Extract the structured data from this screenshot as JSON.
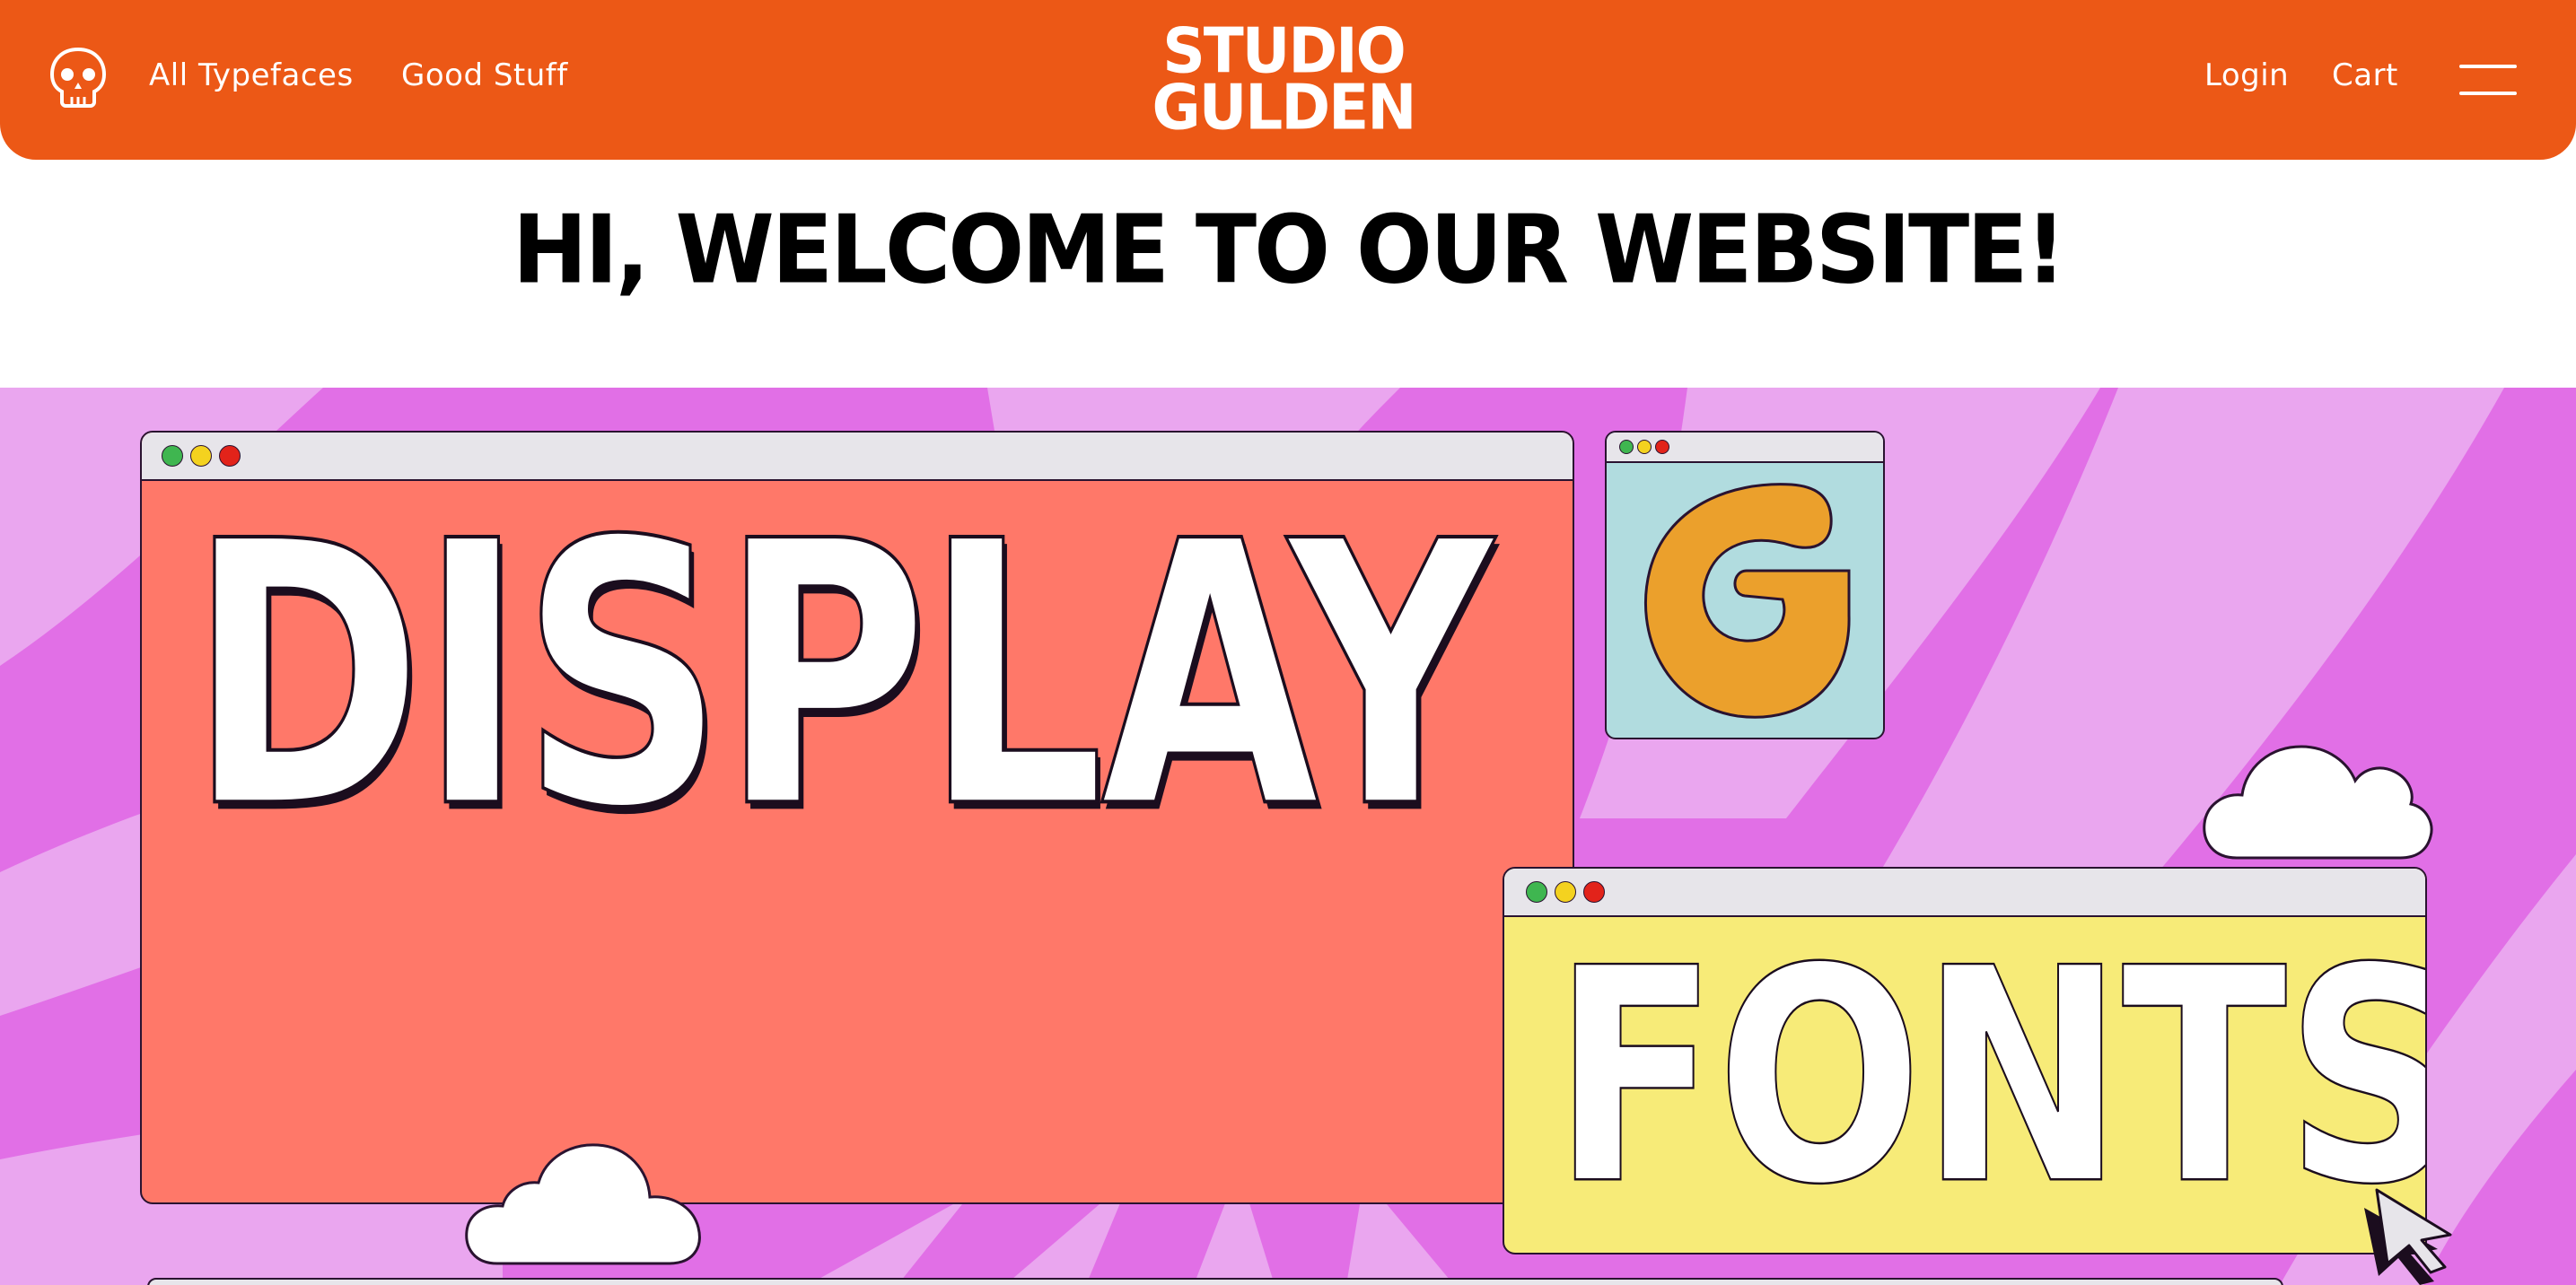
{
  "header": {
    "brand_color": "#ec5816",
    "icon": "skull-icon",
    "nav": [
      "All Typefaces",
      "Good Stuff"
    ],
    "logo_lines": [
      "STUDIO",
      "GULDEN"
    ],
    "right_nav": [
      "Login",
      "Cart"
    ],
    "menu_icon": "hamburger-menu-icon"
  },
  "welcome": {
    "text": "HI, WELCOME TO OUR WEBSITE!"
  },
  "hero": {
    "background_color": "#e16fe6",
    "stripe_color": "#eaa6ef",
    "windows": [
      {
        "name": "display",
        "word": "DISPLAY",
        "bg": "#ff7869"
      },
      {
        "name": "glyph",
        "word": "G",
        "bg": "#b1dcdf",
        "glyph_color": "#eba02c"
      },
      {
        "name": "fonts",
        "word": "FONTS",
        "bg": "#f7eb78"
      }
    ],
    "window_dots": [
      "#3fb650",
      "#f4d21f",
      "#e2231a"
    ],
    "icons": [
      "cloud-icon",
      "mouse-cursor-icon"
    ]
  }
}
